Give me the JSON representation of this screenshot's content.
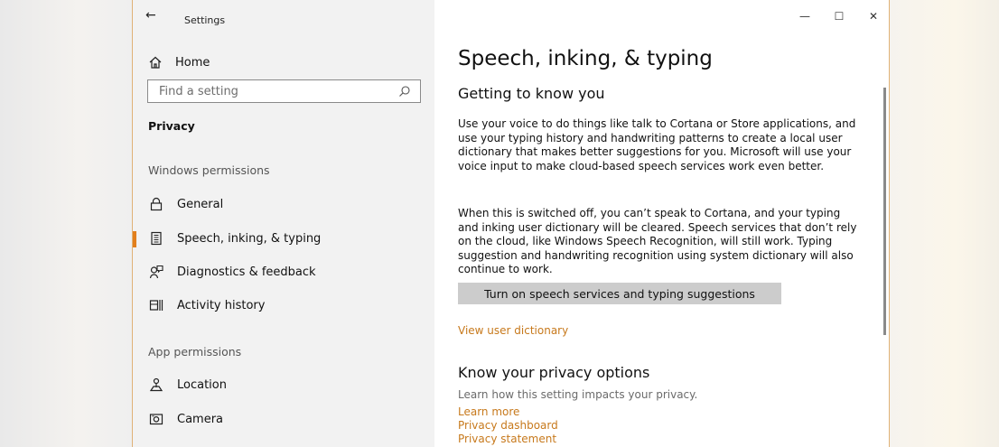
{
  "window": {
    "app_title": "Settings",
    "back_glyph": "←",
    "controls": {
      "minimize": "—",
      "maximize": "☐",
      "close": "✕"
    }
  },
  "sidebar": {
    "home_label": "Home",
    "search_placeholder": "Find a setting",
    "section_title": "Privacy",
    "windows_permissions_title": "Windows permissions",
    "windows_items": [
      {
        "label": "General",
        "icon": "lock-icon"
      },
      {
        "label": "Speech, inking, & typing",
        "icon": "notebook-icon",
        "selected": true
      },
      {
        "label": "Diagnostics & feedback",
        "icon": "feedback-icon"
      },
      {
        "label": "Activity history",
        "icon": "activity-icon"
      }
    ],
    "app_permissions_title": "App permissions",
    "app_items": [
      {
        "label": "Location",
        "icon": "location-icon"
      },
      {
        "label": "Camera",
        "icon": "camera-icon"
      }
    ]
  },
  "main": {
    "title": "Speech, inking, & typing",
    "subhead": "Getting to know you",
    "para1": "Use your voice to do things like talk to Cortana or Store applications, and use your typing history and handwriting patterns to create a local user dictionary that makes better suggestions for you. Microsoft will use your voice input to make cloud-based speech services work even better.",
    "para2": "When this is switched off, you can’t speak to Cortana, and your typing and inking user dictionary will be cleared. Speech services that don’t rely on the cloud, like Windows Speech Recognition, will still work. Typing suggestion and handwriting recognition using system dictionary will also continue to work.",
    "button_label": "Turn on speech services and typing suggestions",
    "view_dictionary_link": "View user dictionary",
    "privacy_subhead": "Know your privacy options",
    "privacy_desc": "Learn how this setting impacts your privacy.",
    "links": [
      "Learn more",
      "Privacy dashboard",
      "Privacy statement"
    ]
  },
  "colors": {
    "accent": "#e27f1c",
    "link": "#c7791c",
    "sidebar_bg": "#f2f2f2",
    "main_bg": "#ffffff",
    "button_bg": "#cccccc"
  }
}
